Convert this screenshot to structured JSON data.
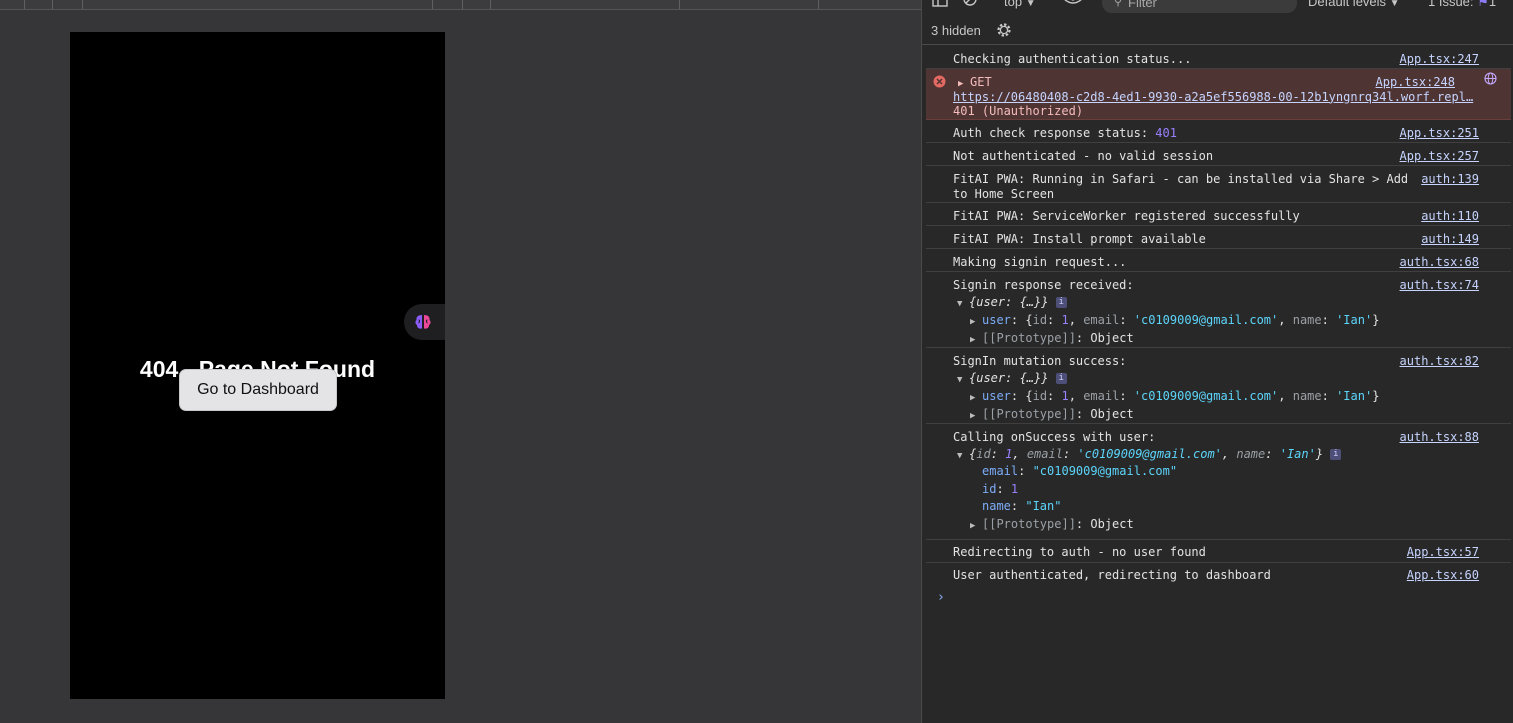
{
  "page": {
    "title": "404 - Page Not Found",
    "button_label": "Go to Dashboard"
  },
  "devtools": {
    "context": "top",
    "filter_placeholder": "Filter",
    "levels": "Default levels",
    "issues": "1 Issue:",
    "issues_count": "1",
    "hidden": "3 hidden"
  },
  "logs": {
    "l1": {
      "text": "Checking authentication status...",
      "src": "App.tsx:247"
    },
    "l2": {
      "method": "GET",
      "url": "https://06480408-c2d8-4ed1-9930-a2a5ef556988-00-12b1yngnrq34l.worf.repl…",
      "status": "401 (Unauthorized)",
      "src": "App.tsx:248"
    },
    "l3": {
      "text": "Auth check response status: ",
      "value": "401",
      "src": "App.tsx:251"
    },
    "l4": {
      "text": "Not authenticated - no valid session",
      "src": "App.tsx:257"
    },
    "l5": {
      "line1": "FitAI PWA: Running in Safari - can be installed via Share > Add",
      "line2": "to Home Screen",
      "src": "auth:139"
    },
    "l6": {
      "text": "FitAI PWA: ServiceWorker registered successfully",
      "src": "auth:110"
    },
    "l7": {
      "text": "FitAI PWA: Install prompt available",
      "src": "auth:149"
    },
    "l8": {
      "text": "Making signin request...",
      "src": "auth.tsx:68"
    },
    "l9": {
      "text": "Signin response received:",
      "src": "auth.tsx:74"
    },
    "l10": {
      "text": "SignIn mutation success:",
      "src": "auth.tsx:82"
    },
    "l11": {
      "text": "Calling onSuccess with user:",
      "src": "auth.tsx:88"
    },
    "l12": {
      "text": "Redirecting to auth - no user found",
      "src": "App.tsx:57"
    },
    "l13": {
      "text": "User authenticated, redirecting to dashboard",
      "src": "App.tsx:60"
    }
  },
  "obj": {
    "collapsed_user": "{user: {…}}",
    "user_key": "user",
    "id_key": "id",
    "id_val": "1",
    "email_key": "email",
    "email_val": "'c0109009@gmail.com'",
    "email_val_dq": "\"c0109009@gmail.com\"",
    "name_key": "name",
    "name_val": "'Ian'",
    "name_val_dq": "\"Ian\"",
    "prototype": "[[Prototype]]",
    "prototype_val": "Object"
  }
}
